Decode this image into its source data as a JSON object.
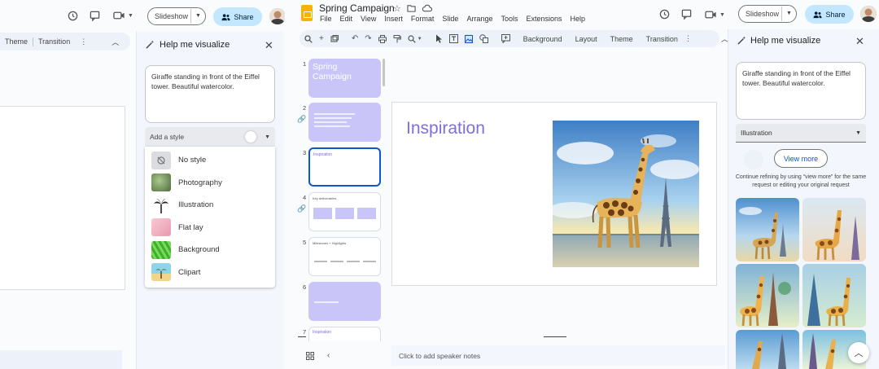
{
  "app": {
    "doc_title": "Spring Campaign",
    "menu": [
      "File",
      "Edit",
      "View",
      "Insert",
      "Format",
      "Slide",
      "Arrange",
      "Tools",
      "Extensions",
      "Help"
    ],
    "slideshow_label": "Slideshow",
    "share_label": "Share"
  },
  "toolbar": {
    "background_label": "Background",
    "layout_label": "Layout",
    "theme_label": "Theme",
    "transition_label": "Transition"
  },
  "left_screen": {
    "toolbar_theme": "Theme",
    "toolbar_transition": "Transition",
    "slideshow_label": "Slideshow",
    "share_label": "Share",
    "panel_title": "Help me visualize",
    "prompt": "Giraffe standing in front of the Eiffel tower. Beautiful watercolor.",
    "style_placeholder": "Add a style",
    "styles": [
      {
        "label": "No style",
        "color": "#dadce0"
      },
      {
        "label": "Photography",
        "color": "#6a8f5a"
      },
      {
        "label": "Illustration",
        "color": "#ffffff"
      },
      {
        "label": "Flat lay",
        "color": "#f2b8c6"
      },
      {
        "label": "Background",
        "color": "#56c23a"
      },
      {
        "label": "Clipart",
        "color": "#7ec8e3"
      }
    ]
  },
  "filmstrip": {
    "slides": [
      {
        "num": "1",
        "title": "Spring Campaign"
      },
      {
        "num": "2",
        "title": ""
      },
      {
        "num": "3",
        "title": "Inspiration"
      },
      {
        "num": "4",
        "title": "Key deliverables"
      },
      {
        "num": "5",
        "title": "Milestones + Highlights"
      },
      {
        "num": "6",
        "title": ""
      },
      {
        "num": "7",
        "title": "Inspiration"
      }
    ]
  },
  "slide": {
    "title": "Inspiration"
  },
  "notes_placeholder": "Click to add speaker notes",
  "right_panel": {
    "title": "Help me visualize",
    "prompt": "Giraffe standing in front of the Eiffel tower. Beautiful watercolor.",
    "style_selected": "Illustration",
    "view_more_label": "View more",
    "hint": "Continue refining by using “view more” for the same request or editing your original request"
  },
  "colors": {
    "accent_blue": "#0b57d0",
    "share_bg": "#c2e7ff",
    "slide_purple": "#c9c5f9",
    "title_purple": "#7e6ee0",
    "docs_yellow": "#f4b400"
  }
}
